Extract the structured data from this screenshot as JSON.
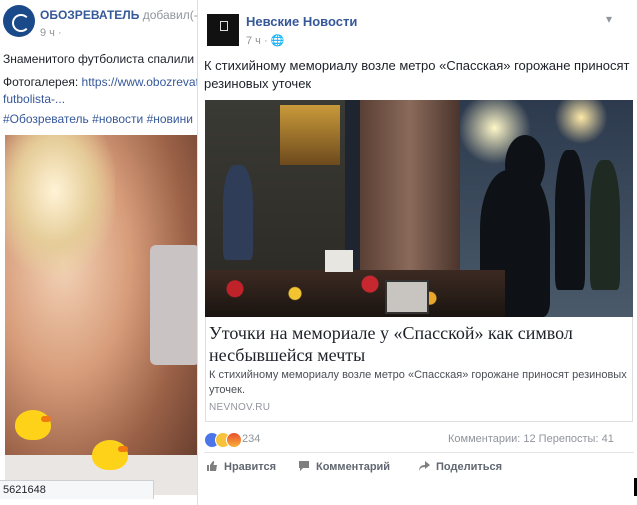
{
  "left_post": {
    "page_name": "ОБОЗРЕВАТЕЛЬ",
    "added_text": "добавил(-а",
    "time": "9 ч ·",
    "text_line1": "Знаменитого футболиста спалили на",
    "gallery_label": "Фотогалерея: ",
    "gallery_link": "https://www.obozrevate",
    "gallery_link_cont": "futbolista-...",
    "hashtags": "#Обозреватель #новости #новини",
    "photo_id": "5621648"
  },
  "right_post": {
    "page_name": "Невские Новости",
    "time": "7 ч · 🌐",
    "menu_caret": "▾",
    "text": "К стихийному мемориалу возле метро «Спасская» горожане приносят резиновых уточек",
    "link": {
      "title": "Уточки на мемориале у «Спасской» как символ несбывшейся мечты",
      "description": "К стихийному мемориалу возле метро «Спасская» горожане приносят резиновых уточек.",
      "domain": "NEVNOV.RU"
    },
    "reactions_count": "234",
    "stats": "Комментарии: 12   Перепосты: 41",
    "actions": {
      "like": "Нравится",
      "comment": "Комментарий",
      "share": "Поделиться"
    }
  },
  "icons": {
    "like": "thumbs-up-icon",
    "comment": "comment-icon",
    "share": "share-arrow-icon"
  },
  "colors": {
    "link_blue": "#365899",
    "meta_gray": "#90949c",
    "like_blue": "#4a76e8"
  }
}
